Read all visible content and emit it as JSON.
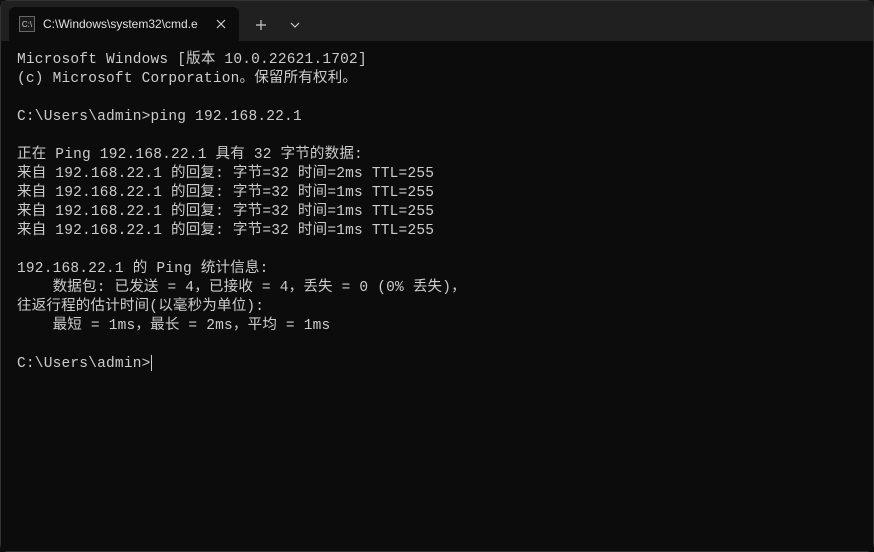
{
  "tab": {
    "title": "C:\\Windows\\system32\\cmd.e",
    "icon_text": "C:\\"
  },
  "terminal": {
    "header_line1": "Microsoft Windows [版本 10.0.22621.1702]",
    "header_line2": "(c) Microsoft Corporation。保留所有权利。",
    "prompt1": "C:\\Users\\admin>",
    "command1": "ping 192.168.22.1",
    "ping_header": "正在 Ping 192.168.22.1 具有 32 字节的数据:",
    "replies": [
      "来自 192.168.22.1 的回复: 字节=32 时间=2ms TTL=255",
      "来自 192.168.22.1 的回复: 字节=32 时间=1ms TTL=255",
      "来自 192.168.22.1 的回复: 字节=32 时间=1ms TTL=255",
      "来自 192.168.22.1 的回复: 字节=32 时间=1ms TTL=255"
    ],
    "stats_header": "192.168.22.1 的 Ping 统计信息:",
    "stats_packets": "    数据包: 已发送 = 4，已接收 = 4，丢失 = 0 (0% 丢失)，",
    "stats_rtt_header": "往返行程的估计时间(以毫秒为单位):",
    "stats_rtt_values": "    最短 = 1ms，最长 = 2ms，平均 = 1ms",
    "prompt2": "C:\\Users\\admin>"
  }
}
